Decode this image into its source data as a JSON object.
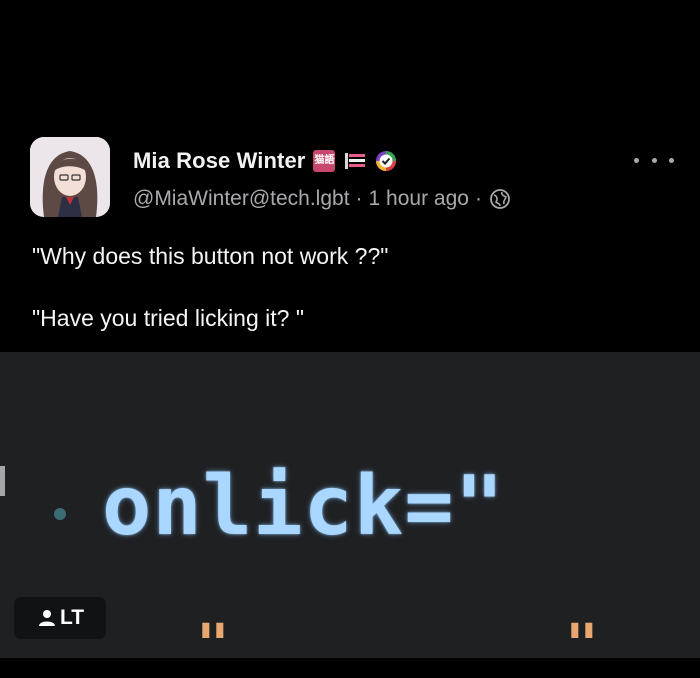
{
  "post": {
    "author": {
      "display_name": "Mia Rose Winter",
      "handle": "@MiaWinter@tech.lgbt",
      "emoji_badge_text": "猫語"
    },
    "meta": {
      "separator": "·",
      "time": "1 hour ago",
      "visibility_icon": "globe-icon"
    },
    "lines": [
      "\"Why does this button not work ??\"",
      "\"Have you tried licking it? \""
    ],
    "more_icon": "ellipsis-icon"
  },
  "media": {
    "code_text": "onlick=\"",
    "quote_marks": [
      "\"",
      "\""
    ],
    "alt_badge_label": "LT",
    "alt_icon": "person-icon"
  },
  "colors": {
    "background": "#000000",
    "secondary_text": "#a9a9ad",
    "code_text": "#a9d7ff",
    "code_background": "#1f2022",
    "string_color": "#e8a770"
  }
}
